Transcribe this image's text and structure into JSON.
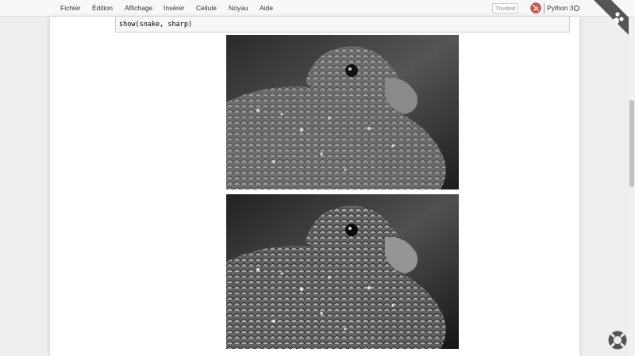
{
  "menu": {
    "items": [
      "Fichier",
      "Édition",
      "Affichage",
      "Insérer",
      "Cellule",
      "Noyau",
      "Aide"
    ]
  },
  "status": {
    "trusted": "Trusted",
    "kernel": "Python 3"
  },
  "cell": {
    "code": "show(snake, sharp)"
  },
  "icons": {
    "readonly": "no-edit-icon",
    "kernel_idle": "circle-icon",
    "help": "lifebuoy-icon"
  },
  "colors": {
    "readonly_icon": "#c0392b",
    "ribbon": "#555555"
  }
}
